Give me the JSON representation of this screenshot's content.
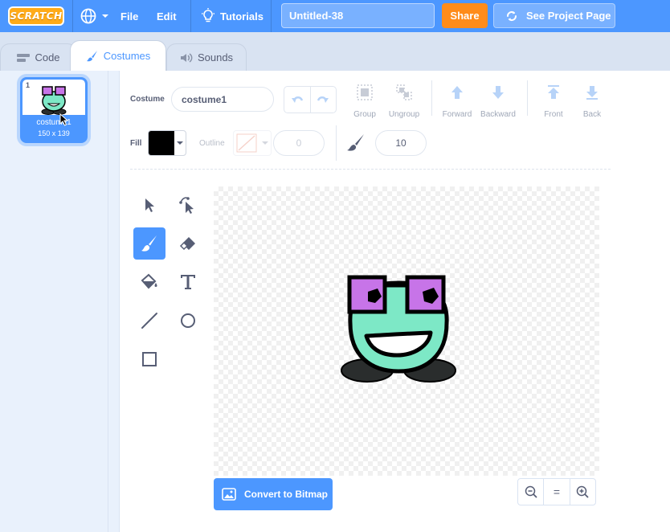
{
  "menu": {
    "logo_text": "SCRATCH",
    "file_label": "File",
    "edit_label": "Edit",
    "tutorials_label": "Tutorials",
    "project_title": "Untitled-38",
    "share_label": "Share",
    "see_project_label": "See Project Page"
  },
  "tabs": [
    {
      "label": "Code",
      "icon": "code-icon"
    },
    {
      "label": "Costumes",
      "icon": "brush-icon"
    },
    {
      "label": "Sounds",
      "icon": "speaker-icon"
    }
  ],
  "costume_list": [
    {
      "number": "1",
      "name": "costume1",
      "size": "150 x 139"
    }
  ],
  "editor": {
    "costume_label": "Costume",
    "costume_name": "costume1",
    "group_label": "Group",
    "ungroup_label": "Ungroup",
    "forward_label": "Forward",
    "backward_label": "Backward",
    "front_label": "Front",
    "back_label": "Back",
    "fill_label": "Fill",
    "outline_label": "Outline",
    "outline_width": "0",
    "brush_size": "10",
    "fill_color": "#000000"
  },
  "tools": [
    "select-icon",
    "reshape-icon",
    "brush-icon",
    "eraser-icon",
    "fill-icon",
    "text-icon",
    "line-icon",
    "circle-icon",
    "rectangle-icon"
  ],
  "convert_button": "Convert to Bitmap",
  "zoom": {
    "zoom_out": "−",
    "reset": "=",
    "zoom_in": "+"
  },
  "colors": {
    "accent": "#4c97ff",
    "share": "#ff8c1a",
    "logo": "#ffab19",
    "face": "#7de8c6",
    "glasses": "#c774e8"
  }
}
